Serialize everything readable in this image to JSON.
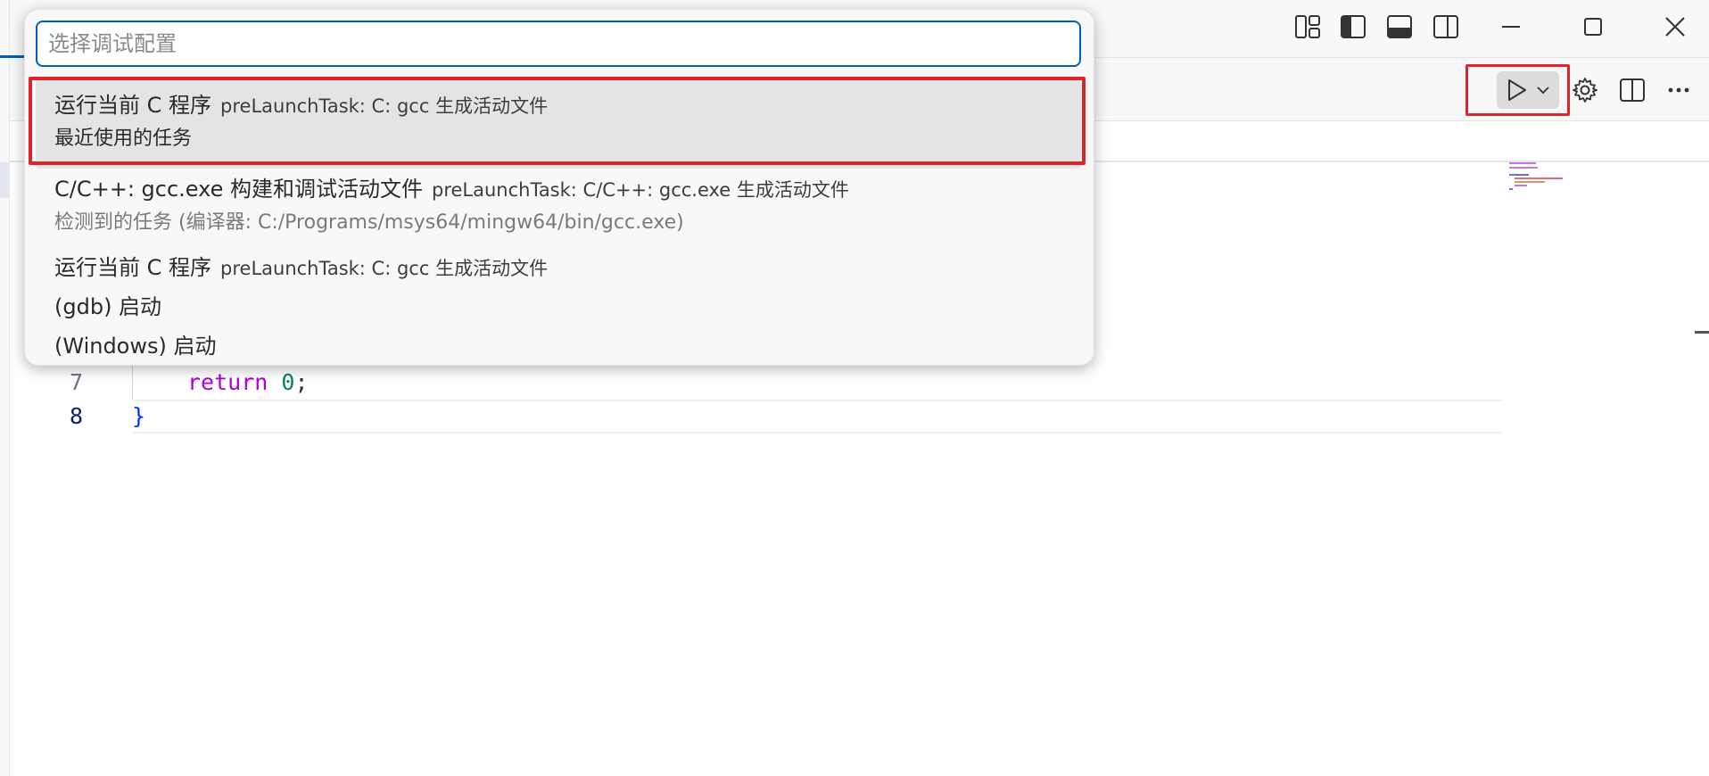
{
  "quickpick": {
    "placeholder": "选择调试配置",
    "items": [
      {
        "label": "运行当前 C 程序",
        "description": "preLaunchTask: C: gcc 生成活动文件",
        "detail": "最近使用的任务"
      },
      {
        "label": "C/C++: gcc.exe 构建和调试活动文件",
        "description": "preLaunchTask: C/C++: gcc.exe 生成活动文件",
        "detail": "检测到的任务 (编译器: C:/Programs/msys64/mingw64/bin/gcc.exe)"
      },
      {
        "label": "运行当前 C 程序",
        "description": "preLaunchTask: C: gcc 生成活动文件"
      },
      {
        "label": "(gdb) 启动"
      },
      {
        "label": "(Windows) 启动"
      }
    ]
  },
  "editor": {
    "lines": [
      {
        "number": "7",
        "code_keyword": "return",
        "code_number": "0",
        "code_punct": ";"
      },
      {
        "number": "8",
        "code_brace": "}"
      }
    ]
  },
  "colors": {
    "accent": "#005fb8",
    "highlight_box": "#e0242c",
    "keyword": "#af00db",
    "number": "#098658",
    "brace": "#0431fa"
  },
  "icons": {
    "title_bar": [
      "customize-layout-icon",
      "toggle-primary-sidebar-icon",
      "toggle-panel-icon",
      "toggle-secondary-sidebar-icon",
      "minimize-icon",
      "maximize-icon",
      "close-icon"
    ],
    "editor_toolbar": [
      "run-icon",
      "chevron-down-icon",
      "gear-icon",
      "split-editor-icon",
      "more-actions-icon"
    ]
  }
}
